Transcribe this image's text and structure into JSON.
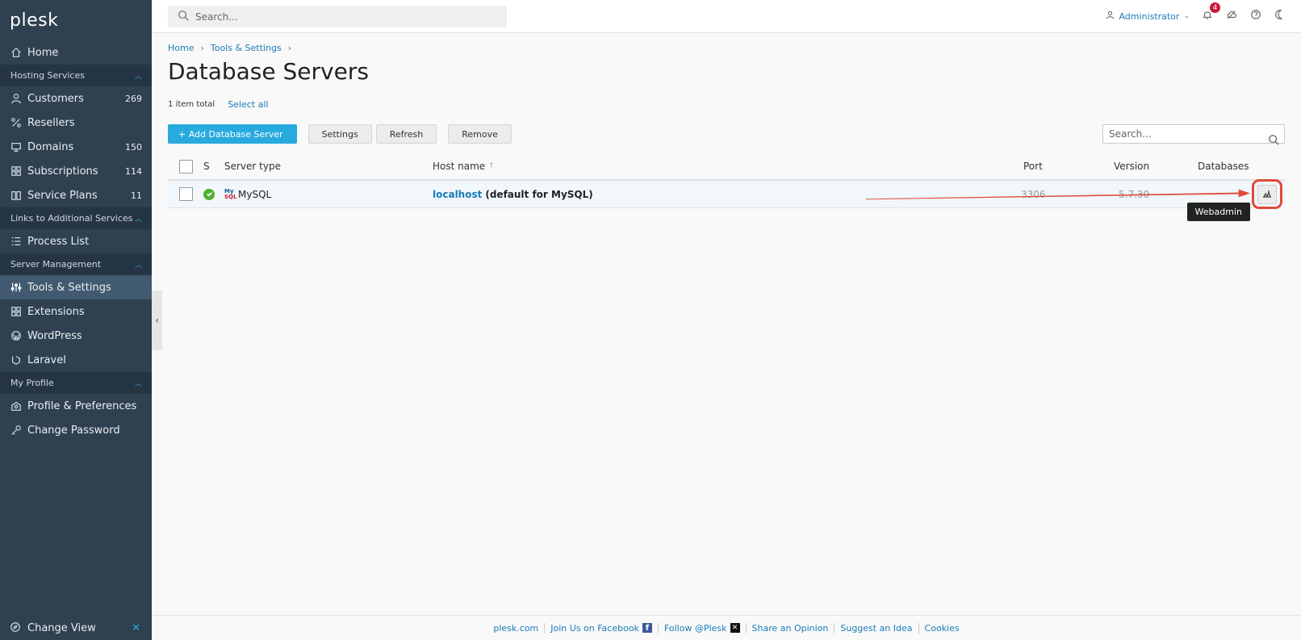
{
  "sidebar": {
    "logo_text": "plesk",
    "home": "Home",
    "sections": {
      "hosting": "Hosting Services",
      "links": "Links to Additional Services",
      "server": "Server Management",
      "profile": "My Profile"
    },
    "items": {
      "customers": {
        "label": "Customers",
        "count": "269"
      },
      "resellers": {
        "label": "Resellers"
      },
      "domains": {
        "label": "Domains",
        "count": "150"
      },
      "subscriptions": {
        "label": "Subscriptions",
        "count": "114"
      },
      "service_plans": {
        "label": "Service Plans",
        "count": "11"
      },
      "process_list": {
        "label": "Process List"
      },
      "tools_settings": {
        "label": "Tools & Settings"
      },
      "extensions": {
        "label": "Extensions"
      },
      "wordpress": {
        "label": "WordPress"
      },
      "laravel": {
        "label": "Laravel"
      },
      "profile_prefs": {
        "label": "Profile & Preferences"
      },
      "change_password": {
        "label": "Change Password"
      }
    },
    "change_view": "Change View"
  },
  "topbar": {
    "search_placeholder": "Search...",
    "user": "Administrator",
    "notifications_count": "4"
  },
  "breadcrumb": [
    "Home",
    "Tools & Settings"
  ],
  "page_title": "Database Servers",
  "summary": {
    "total": "1 item total",
    "select_all": "Select all"
  },
  "toolbar": {
    "add": "Add Database Server",
    "settings": "Settings",
    "refresh": "Refresh",
    "remove": "Remove",
    "search_placeholder": "Search..."
  },
  "table": {
    "columns": {
      "status": "S",
      "server_type": "Server type",
      "host_name": "Host name",
      "port": "Port",
      "version": "Version",
      "databases": "Databases"
    },
    "rows": [
      {
        "server_type": "MySQL",
        "host_link": "localhost",
        "host_rest": "(default for MySQL)",
        "port": "3306",
        "version": "5.7.30",
        "tooltip": "Webadmin"
      }
    ]
  },
  "footer": {
    "links": [
      "plesk.com",
      "Join Us on Facebook",
      "Follow @Plesk",
      "Share an Opinion",
      "Suggest an Idea",
      "Cookies"
    ]
  },
  "colors": {
    "accent": "#28aade",
    "sidebar": "#2f4050",
    "highlight": "#e04a3a"
  }
}
